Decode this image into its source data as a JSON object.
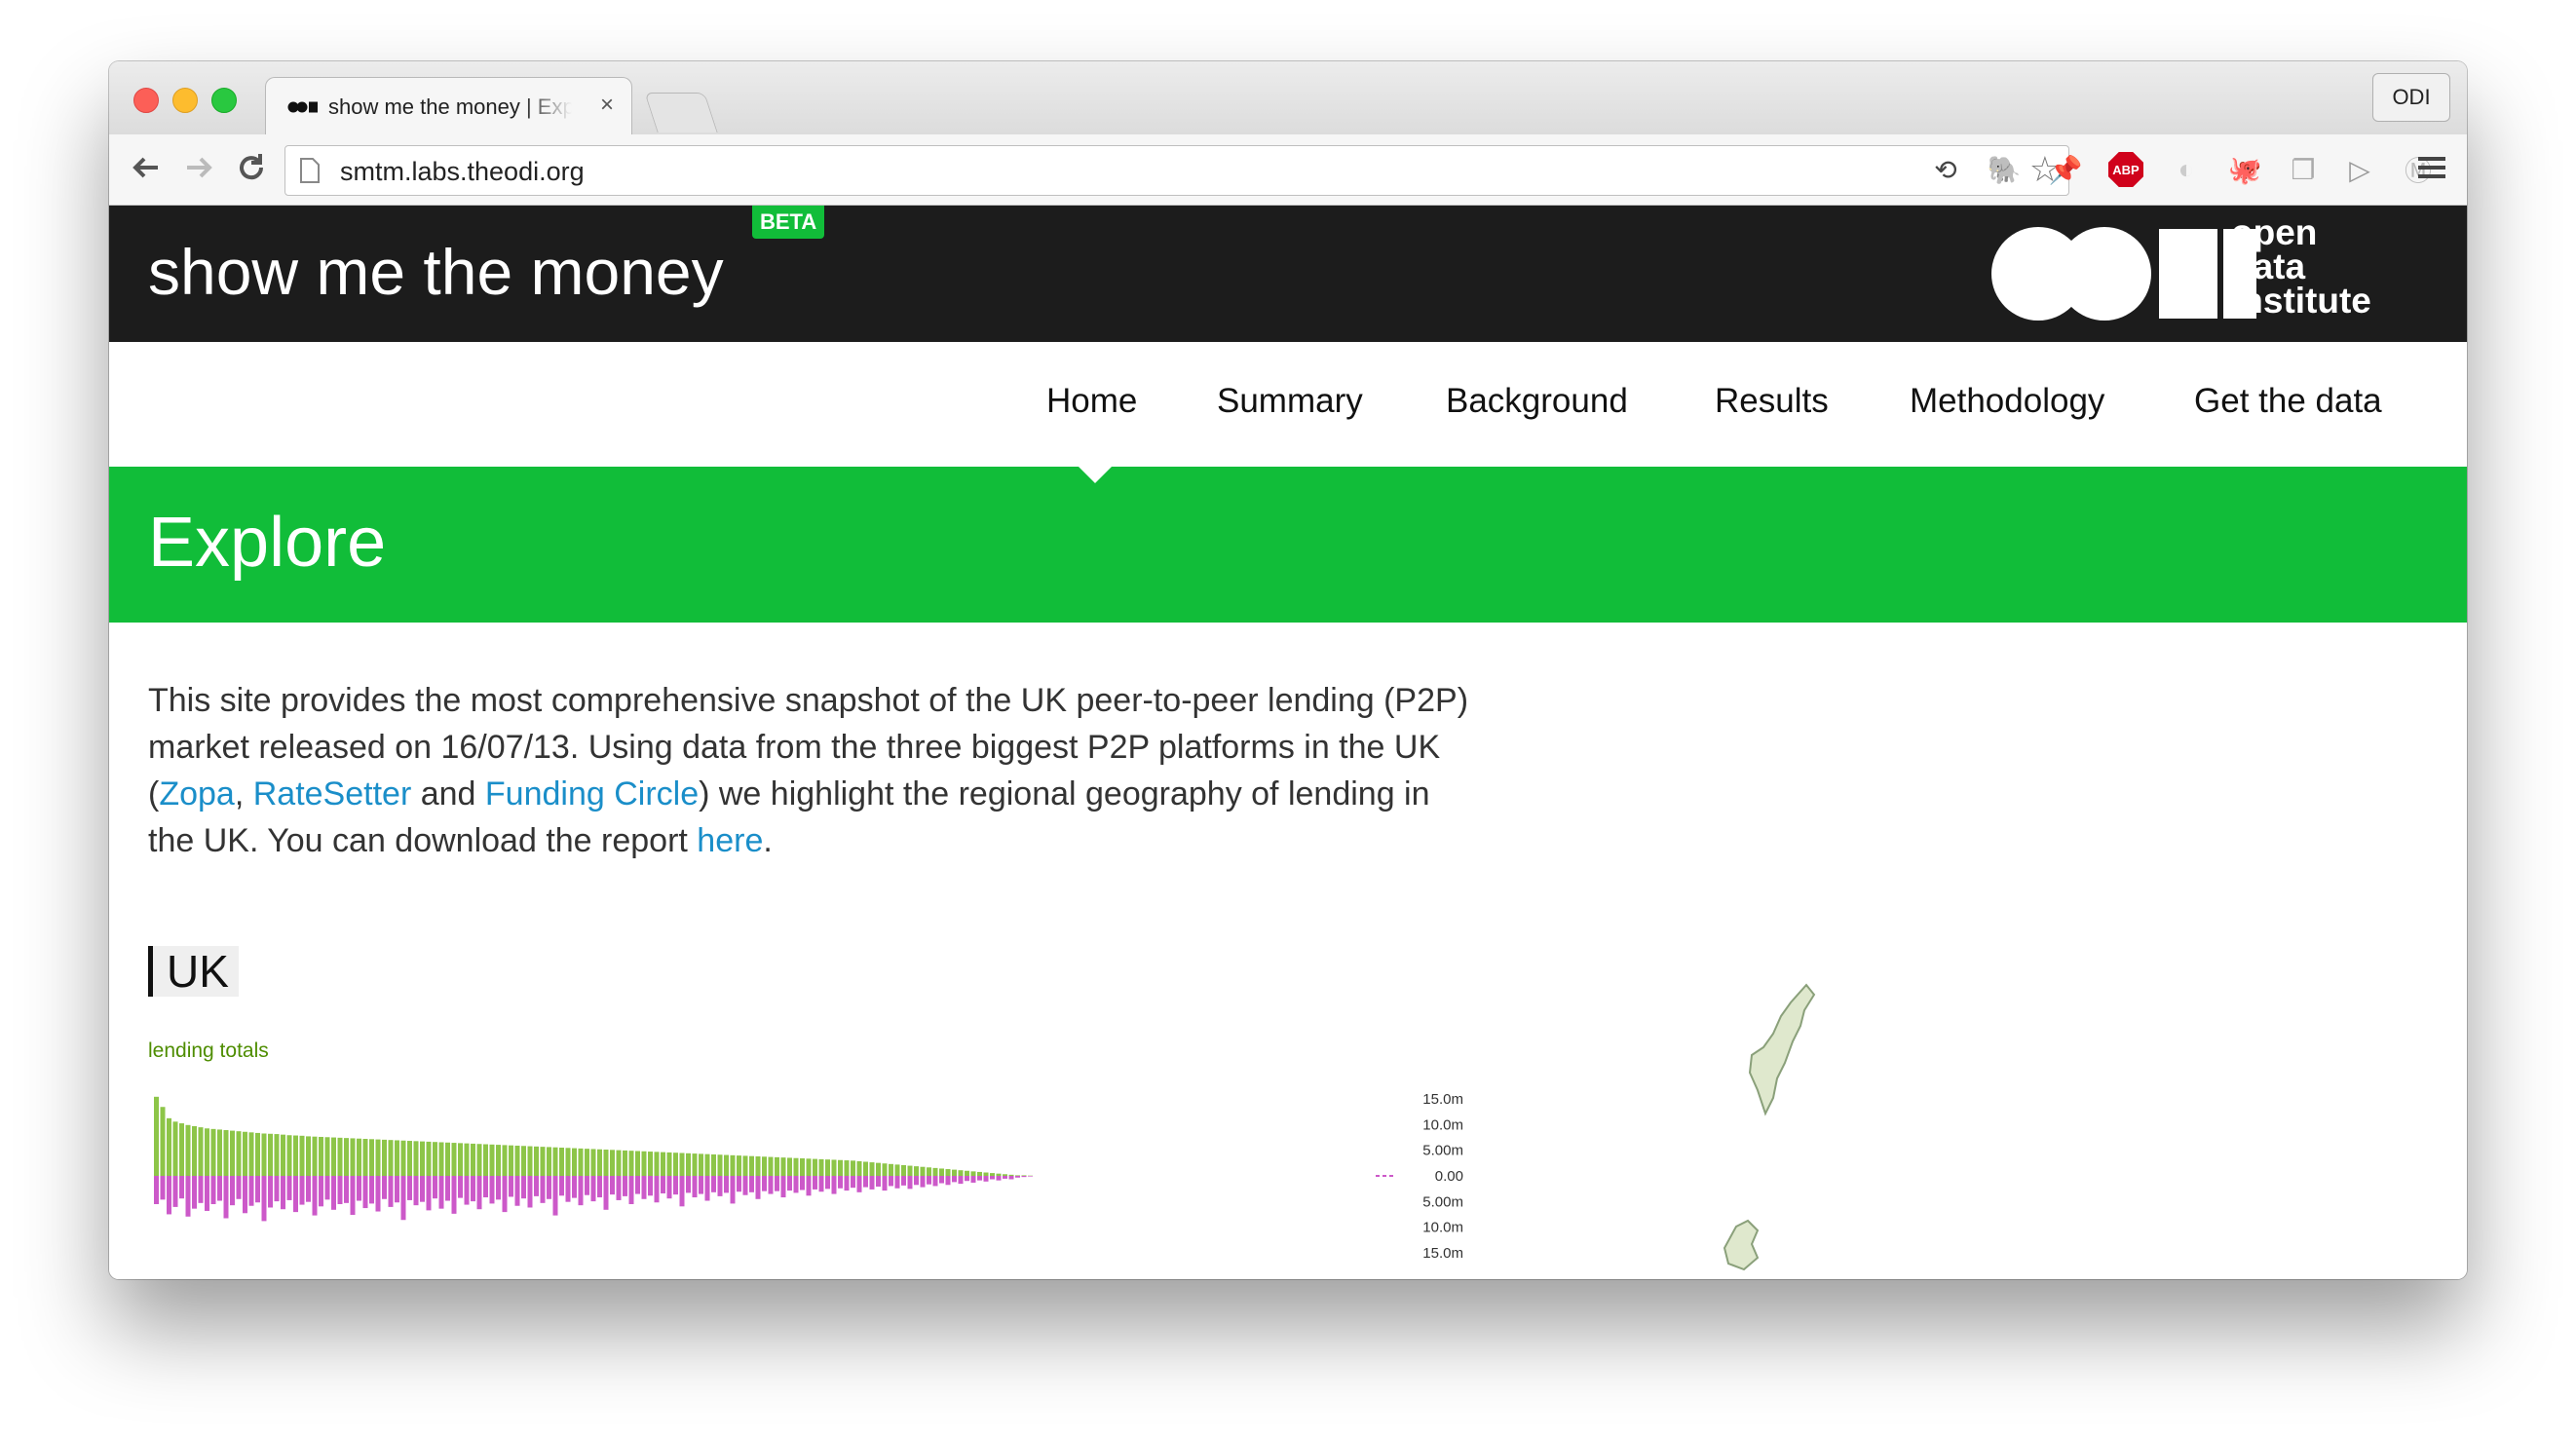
{
  "browser": {
    "tab_title": "show me the money | Explore",
    "tab_close": "×",
    "profile_label": "ODI",
    "url": "smtm.labs.theodi.org",
    "abp_badge": "ABP"
  },
  "site": {
    "title": "show me the money",
    "beta_badge": "BETA",
    "logo_text": [
      "open",
      "data",
      "institute"
    ]
  },
  "nav": {
    "items": [
      "Home",
      "Summary",
      "Background",
      "Results",
      "Methodology",
      "Get the data"
    ],
    "active": "Home"
  },
  "banner": {
    "title": "Explore"
  },
  "intro": {
    "text_1": "This site provides the most comprehensive snapshot of the UK peer-to-peer lending (P2P) market released on 16/07/13. Using data from the three biggest P2P platforms in the UK (",
    "link_zopa": "Zopa",
    "sep_1": ", ",
    "link_ratesetter": "RateSetter",
    "sep_2": " and ",
    "link_funding_circle": "Funding Circle",
    "text_2": ") we highlight the regional geography of lending in the UK. You can download the report ",
    "link_here": "here",
    "text_3": "."
  },
  "section": {
    "heading": "UK",
    "chart_label": "lending totals"
  },
  "colors": {
    "header_bg": "#1c1c1c",
    "accent_green": "#11bd39",
    "link_blue": "#1a8ec9",
    "bar_green": "#8dc548",
    "bar_pink": "#cc59c9"
  },
  "chart_data": {
    "type": "bar",
    "title": "lending totals",
    "ytick_labels_top": [
      "15.0m",
      "10.0m",
      "5.00m",
      "0.00"
    ],
    "ytick_labels_bottom": [
      "5.00m",
      "10.0m",
      "15.0m"
    ],
    "ylim": [
      -15,
      15
    ],
    "units": "m",
    "series": [
      {
        "values": [
          14.0,
          12.2,
          10.2,
          9.6,
          9.3,
          9.0,
          8.8,
          8.6,
          8.4,
          8.3,
          8.2,
          8.1,
          8.0,
          7.9,
          7.8,
          7.7,
          7.6,
          7.5,
          7.45,
          7.4,
          7.3,
          7.2,
          7.15,
          7.1,
          7.0,
          6.95,
          6.9,
          6.85,
          6.8,
          6.75,
          6.7,
          6.65,
          6.6,
          6.55,
          6.5,
          6.45,
          6.4,
          6.35,
          6.3,
          6.25,
          6.2,
          6.15,
          6.1,
          6.05,
          6.0,
          5.95,
          5.9,
          5.85,
          5.8,
          5.75,
          5.7,
          5.65,
          5.6,
          5.55,
          5.5,
          5.45,
          5.4,
          5.35,
          5.3,
          5.25,
          5.2,
          5.15,
          5.1,
          5.05,
          5.0,
          4.95,
          4.9,
          4.85,
          4.8,
          4.75,
          4.7,
          4.65,
          4.6,
          4.55,
          4.5,
          4.45,
          4.4,
          4.35,
          4.3,
          4.25,
          4.2,
          4.15,
          4.1,
          4.05,
          4.0,
          3.95,
          3.9,
          3.85,
          3.8,
          3.75,
          3.7,
          3.65,
          3.6,
          3.55,
          3.5,
          3.45,
          3.4,
          3.35,
          3.3,
          3.25,
          3.2,
          3.15,
          3.1,
          3.05,
          3.0,
          2.95,
          2.9,
          2.85,
          2.8,
          2.75,
          2.7,
          2.6,
          2.5,
          2.4,
          2.3,
          2.2,
          2.1,
          2.0,
          1.9,
          1.8,
          1.7,
          1.6,
          1.5,
          1.4,
          1.3,
          1.2,
          1.1,
          1.0,
          0.9,
          0.8,
          0.7,
          0.6,
          0.5,
          0.4,
          0.3,
          0.2,
          0.1,
          0.1,
          0.05
        ]
      },
      {
        "values": [
          -5.0,
          -4.2,
          -6.8,
          -5.5,
          -4.0,
          -7.2,
          -5.8,
          -4.8,
          -6.2,
          -5.0,
          -4.4,
          -7.5,
          -5.2,
          -4.1,
          -6.6,
          -5.3,
          -4.7,
          -8.0,
          -5.6,
          -4.5,
          -5.9,
          -4.3,
          -6.4,
          -5.1,
          -4.6,
          -7.0,
          -5.4,
          -4.2,
          -6.0,
          -5.0,
          -4.8,
          -6.9,
          -4.4,
          -5.7,
          -4.9,
          -6.3,
          -4.1,
          -5.5,
          -4.7,
          -7.8,
          -4.3,
          -5.2,
          -4.6,
          -6.1,
          -4.0,
          -5.8,
          -4.4,
          -6.7,
          -3.9,
          -5.1,
          -4.5,
          -5.9,
          -3.8,
          -4.9,
          -4.2,
          -6.4,
          -3.7,
          -5.3,
          -4.0,
          -5.6,
          -3.6,
          -4.8,
          -4.1,
          -7.0,
          -3.5,
          -4.6,
          -3.9,
          -5.2,
          -3.4,
          -4.5,
          -3.8,
          -6.0,
          -3.3,
          -4.3,
          -3.6,
          -5.0,
          -3.2,
          -4.1,
          -3.5,
          -4.7,
          -3.1,
          -4.0,
          -3.3,
          -5.4,
          -3.0,
          -3.8,
          -3.2,
          -4.4,
          -2.9,
          -3.6,
          -3.0,
          -4.9,
          -2.8,
          -3.4,
          -2.9,
          -4.1,
          -2.7,
          -3.2,
          -2.7,
          -3.8,
          -2.6,
          -3.0,
          -2.5,
          -3.5,
          -2.4,
          -2.8,
          -2.3,
          -3.2,
          -2.2,
          -2.6,
          -2.1,
          -2.9,
          -2.0,
          -2.4,
          -1.9,
          -2.6,
          -1.8,
          -2.2,
          -1.7,
          -2.3,
          -1.6,
          -2.0,
          -1.5,
          -1.8,
          -1.3,
          -1.6,
          -1.1,
          -1.4,
          -0.9,
          -1.2,
          -0.8,
          -1.0,
          -0.6,
          -0.8,
          -0.5,
          -0.6,
          -0.3,
          -0.2,
          -0.1
        ]
      }
    ]
  }
}
